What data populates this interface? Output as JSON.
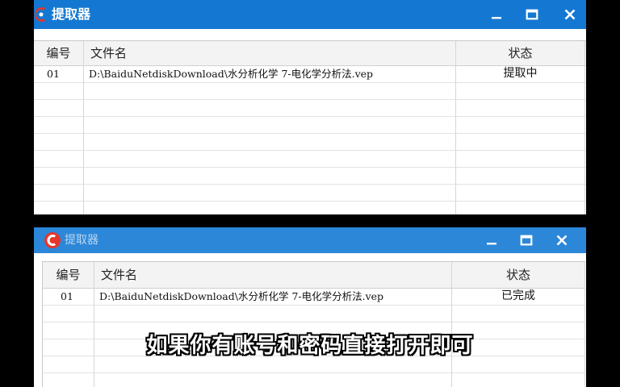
{
  "colors": {
    "titlebar_top": "#1478d2",
    "titlebar_bottom": "#2c87d8",
    "icon_red": "#e5362c",
    "background": "#000000"
  },
  "window_top": {
    "title": "提取器",
    "columns": [
      "编号",
      "文件名",
      "状态"
    ],
    "rows": [
      {
        "id": "01",
        "file": "D:\\BaiduNetdiskDownload\\水分析化学 7-电化学分析法.vep",
        "status": "提取中"
      }
    ]
  },
  "window_bottom": {
    "title": "提取器",
    "columns": [
      "编号",
      "文件名",
      "状态"
    ],
    "rows": [
      {
        "id": "01",
        "file": "D:\\BaiduNetdiskDownload\\水分析化学 7-电化学分析法.vep",
        "status": "已完成"
      }
    ]
  },
  "icons": [
    "app-logo-icon",
    "minimize-icon",
    "maximize-icon",
    "close-icon"
  ],
  "subtitle": "如果你有账号和密码直接打开即可"
}
